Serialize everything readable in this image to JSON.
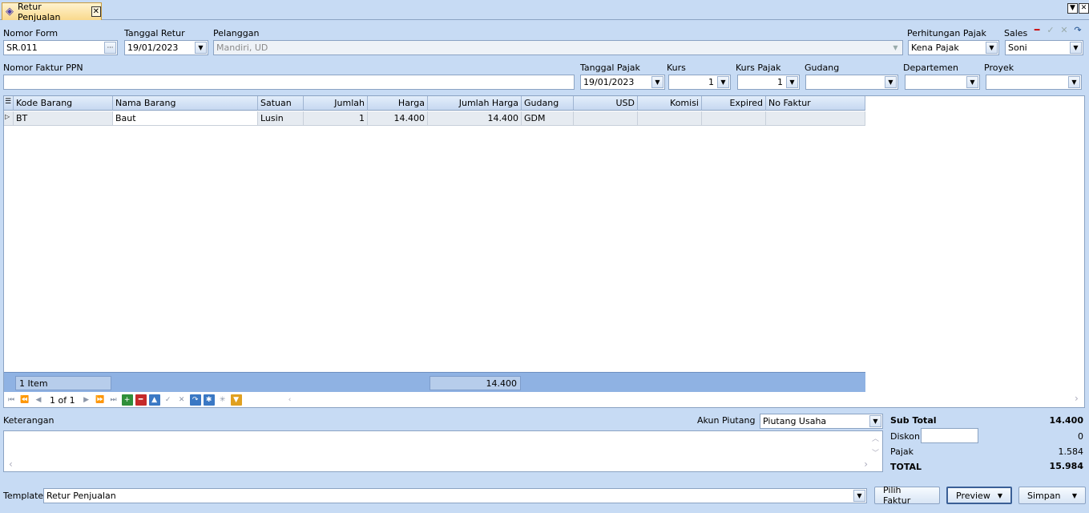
{
  "tab": {
    "title": "Retur Penjualan",
    "close": "✕"
  },
  "window": {
    "menu_glyph": "▼",
    "close_glyph": "✕"
  },
  "form": {
    "nomor_form_label": "Nomor Form",
    "nomor_form_value": "SR.011",
    "nomor_form_browse": "···",
    "tanggal_retur_label": "Tanggal Retur",
    "tanggal_retur_value": "19/01/2023",
    "pelanggan_label": "Pelanggan",
    "pelanggan_value": "Mandiri, UD",
    "perhitungan_pajak_label": "Perhitungan Pajak",
    "perhitungan_pajak_value": "Kena Pajak",
    "sales_label": "Sales",
    "sales_value": "Soni",
    "nomor_faktur_ppn_label": "Nomor Faktur PPN",
    "nomor_faktur_ppn_value": "",
    "tanggal_pajak_label": "Tanggal Pajak",
    "tanggal_pajak_value": "19/01/2023",
    "kurs_label": "Kurs",
    "kurs_value": "1",
    "kurs_pajak_label": "Kurs Pajak",
    "kurs_pajak_value": "1",
    "gudang_label": "Gudang",
    "gudang_value": "",
    "departemen_label": "Departemen",
    "departemen_value": "",
    "proyek_label": "Proyek",
    "proyek_value": ""
  },
  "grid": {
    "columns": [
      "Kode Barang",
      "Nama Barang",
      "Satuan",
      "Jumlah",
      "Harga",
      "Jumlah Harga",
      "Gudang",
      "USD",
      "Komisi",
      "Expired",
      "No Faktur"
    ],
    "rows": [
      {
        "kode": "BT",
        "nama": "Baut",
        "satuan": "Lusin",
        "jumlah": "1",
        "harga": "14.400",
        "jumlah_harga": "14.400",
        "gudang": "GDM",
        "usd": "",
        "komisi": "",
        "expired": "",
        "no_faktur": ""
      }
    ],
    "footer_count": "1 Item",
    "footer_total": "14.400",
    "pager": "1 of 1"
  },
  "bottom": {
    "keterangan_label": "Keterangan",
    "keterangan_value": "",
    "akun_piutang_label": "Akun Piutang",
    "akun_piutang_value": "Piutang Usaha",
    "sub_total_label": "Sub Total",
    "sub_total_value": "14.400",
    "diskon_label": "Diskon",
    "diskon_input": "",
    "diskon_value": "0",
    "pajak_label": "Pajak",
    "pajak_value": "1.584",
    "total_label": "TOTAL",
    "total_value": "15.984",
    "template_label": "Template",
    "template_value": "Retur Penjualan",
    "pilih_faktur": "Pilih Faktur",
    "preview": "Preview",
    "simpan": "Simpan"
  },
  "colors": {
    "background": "#c7dbf4",
    "tab_active": "#f9d98c",
    "grid_footer": "#8fb2e3"
  }
}
